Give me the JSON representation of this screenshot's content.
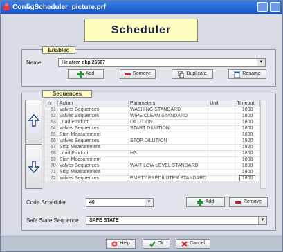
{
  "window": {
    "title": "ConfigScheduler_picture.prf"
  },
  "header": {
    "title": "Scheduler"
  },
  "enabled": {
    "tag": "Enabled",
    "name_label": "Name",
    "name_value": "He atem dkp 26667",
    "buttons": {
      "add": "Add",
      "remove": "Remove",
      "duplicate": "Duplicate",
      "rename": "Rename"
    }
  },
  "sequences": {
    "tag": "Sequences",
    "columns": [
      "nr",
      "Action",
      "Parameters",
      "Unit",
      "Timeout"
    ],
    "rows": [
      [
        "61",
        "Valves Sequences",
        "WASHING STANDARD",
        "",
        "1800"
      ],
      [
        "62",
        "Valves Sequences",
        "WIPE CLEAN STANDARD",
        "",
        "1800"
      ],
      [
        "63",
        "Load Product",
        "DILUTION",
        "",
        "1800"
      ],
      [
        "64",
        "Valves Sequences",
        "START DILUTION",
        "",
        "1800"
      ],
      [
        "65",
        "Start Measurement",
        "",
        "",
        "1800"
      ],
      [
        "66",
        "Valves Sequences",
        "STOP DILUTION",
        "",
        "1800"
      ],
      [
        "67",
        "Stop Measurement",
        "",
        "",
        "1800"
      ],
      [
        "68",
        "Load Product",
        "HS",
        "",
        "1800"
      ],
      [
        "69",
        "Start Measurement",
        "",
        "",
        "1800"
      ],
      [
        "70",
        "Valves Sequences",
        "WAIT LOW LEVEL STANDARD",
        "",
        "1800"
      ],
      [
        "71",
        "Stop Measurement",
        "",
        "",
        "1800"
      ],
      [
        "72",
        "Valves Sequences",
        "EMPTY PREDILUTER STANDARD",
        "",
        "1800"
      ]
    ]
  },
  "code_scheduler": {
    "label": "Code Scheduler",
    "value": "40",
    "add": "Add",
    "remove": "Remove"
  },
  "safe_state": {
    "label": "Safe State Sequence",
    "value": "SAFE STATE"
  },
  "footer": {
    "help": "Help",
    "ok": "Ok",
    "cancel": "Cancel"
  },
  "colors": {
    "titlebar": "#2a67d6",
    "banner": "#ffffc0",
    "add_green": "#1e9a2a",
    "remove_red": "#c8222a"
  }
}
